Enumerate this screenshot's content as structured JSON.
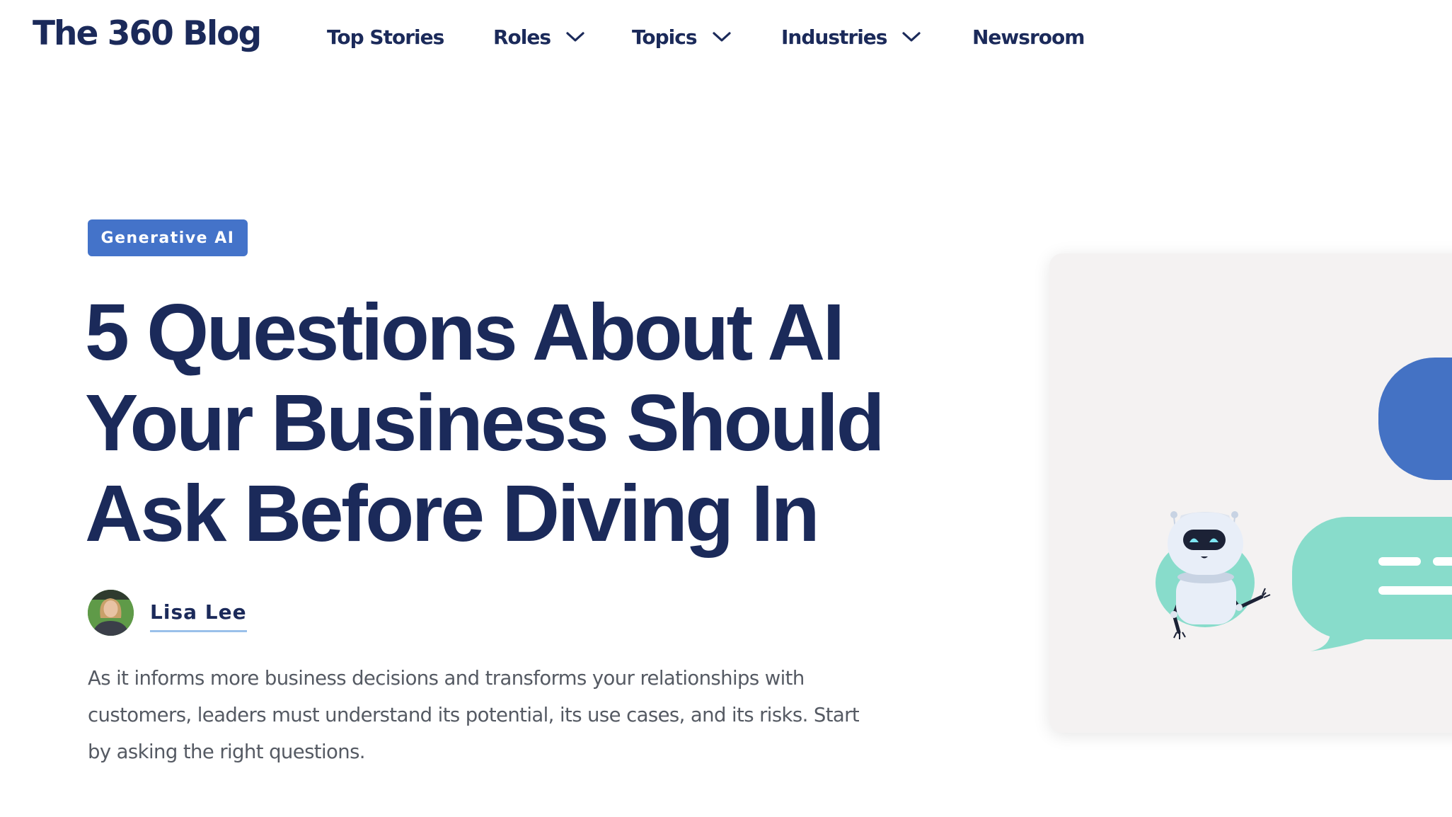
{
  "header": {
    "logo": "The 360 Blog",
    "nav": [
      {
        "label": "Top Stories",
        "has_dropdown": false
      },
      {
        "label": "Roles",
        "has_dropdown": true
      },
      {
        "label": "Topics",
        "has_dropdown": true
      },
      {
        "label": "Industries",
        "has_dropdown": true
      },
      {
        "label": "Newsroom",
        "has_dropdown": false
      }
    ]
  },
  "article": {
    "category_badge": "Generative AI",
    "title_lines": [
      "5 Questions About AI",
      "Your Business Should",
      "Ask Before Diving In"
    ],
    "author": {
      "name": "Lisa Lee",
      "avatar_alt": "Lisa Lee"
    },
    "dek_lines": [
      "As it informs more business decisions and transforms your relationships with",
      "customers, leaders must understand its potential, its use cases, and its risks. Start",
      "by asking the right questions."
    ]
  },
  "illustration": {
    "description": "Robot assistant waving beside chat bubbles",
    "icons": [
      "robot-icon",
      "chat-bubble-icon"
    ]
  },
  "colors": {
    "brand_navy": "#1b2a5a",
    "badge_blue": "#4473c9",
    "bubble_blue": "#4472c4",
    "bubble_mint": "#88dccb",
    "card_bg": "#f4f2f2",
    "author_underline": "#9ac0ea",
    "body_text": "#555a63"
  }
}
